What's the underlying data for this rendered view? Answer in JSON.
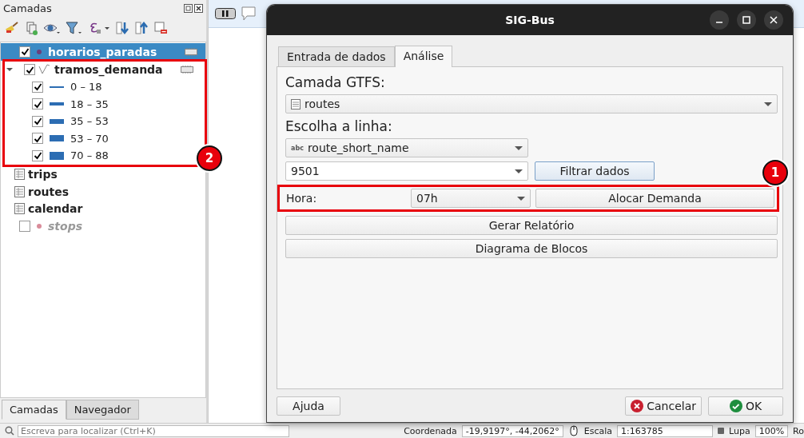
{
  "layers_panel": {
    "title": "Camadas",
    "layers": [
      {
        "name": "horarios_paradas",
        "kind": "point",
        "checked": true,
        "selected": true,
        "disabled": false
      },
      {
        "name": "tramos_demanda",
        "kind": "line",
        "checked": true,
        "selected": false,
        "disabled": false,
        "expanded": true,
        "children": [
          {
            "label": "0 – 18",
            "checked": true
          },
          {
            "label": "18 – 35",
            "checked": true
          },
          {
            "label": "35 – 53",
            "checked": true
          },
          {
            "label": "53 – 70",
            "checked": true
          },
          {
            "label": "70 – 88",
            "checked": true
          }
        ]
      },
      {
        "name": "trips",
        "kind": "table",
        "selected": false,
        "disabled": false
      },
      {
        "name": "routes",
        "kind": "table",
        "selected": false,
        "disabled": false
      },
      {
        "name": "calendar",
        "kind": "table",
        "selected": false,
        "disabled": false
      },
      {
        "name": "stops",
        "kind": "point",
        "checked": false,
        "selected": false,
        "disabled": true
      }
    ]
  },
  "panel_tabs": [
    {
      "label": "Camadas",
      "selected": true
    },
    {
      "label": "Navegador",
      "selected": false
    }
  ],
  "search": {
    "placeholder": "Escreva para localizar (Ctrl+K)"
  },
  "dialog": {
    "title": "SIG-Bus",
    "tabs": [
      {
        "label": "Entrada de dados",
        "selected": false
      },
      {
        "label": "Análise",
        "selected": true
      }
    ],
    "layer_label": "Camada GTFS:",
    "layer_value": "routes",
    "line_label": "Escolha a linha:",
    "field_value": "route_short_name",
    "field_type": "abc",
    "route_value": "9501",
    "filter_button": "Filtrar dados",
    "hour_label": "Hora:",
    "hour_value": "07h",
    "allocate_button": "Alocar Demanda",
    "report_button": "Gerar Relatório",
    "diagram_button": "Diagrama de Blocos",
    "help_button": "Ajuda",
    "cancel_button": "Cancelar",
    "ok_button": "OK"
  },
  "annotations": [
    {
      "label": "1"
    },
    {
      "label": "2"
    }
  ],
  "status_bar": {
    "coordinate_label": "Coordenada",
    "coordinate": "-19,9197°, -44,2062°",
    "scale_label": "Escala",
    "scale": "1:163785",
    "magnifier_label": "Lupa",
    "magnifier": "100%",
    "rotation_label": "Ro"
  }
}
